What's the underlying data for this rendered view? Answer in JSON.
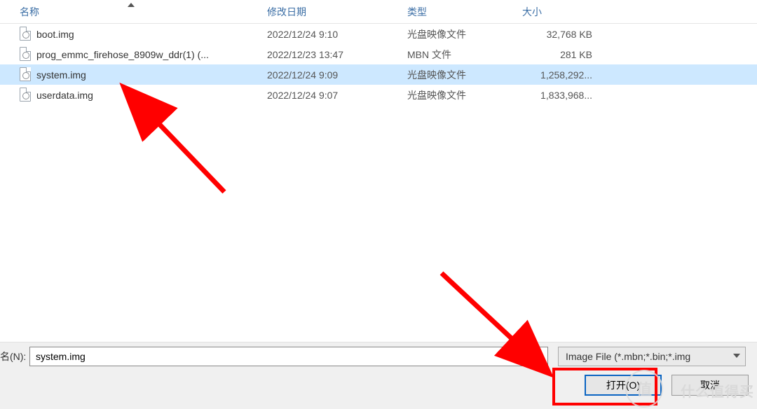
{
  "columns": {
    "name": "名称",
    "date": "修改日期",
    "type": "类型",
    "size": "大小"
  },
  "files": [
    {
      "name": "boot.img",
      "date": "2022/12/24 9:10",
      "type": "光盘映像文件",
      "size": "32,768 KB",
      "selected": false
    },
    {
      "name": "prog_emmc_firehose_8909w_ddr(1) (...",
      "date": "2022/12/23 13:47",
      "type": "MBN 文件",
      "size": "281 KB",
      "selected": false
    },
    {
      "name": "system.img",
      "date": "2022/12/24 9:09",
      "type": "光盘映像文件",
      "size": "1,258,292...",
      "selected": true
    },
    {
      "name": "userdata.img",
      "date": "2022/12/24 9:07",
      "type": "光盘映像文件",
      "size": "1,833,968...",
      "selected": false
    }
  ],
  "bottom": {
    "filename_label": "名(N):",
    "filename_value": "system.img",
    "filter_text": "Image File (*.mbn;*.bin;*.img",
    "open_label": "打开(O)",
    "cancel_label": "取消"
  },
  "watermark": {
    "glyph": "值",
    "text": "什么值得买"
  }
}
